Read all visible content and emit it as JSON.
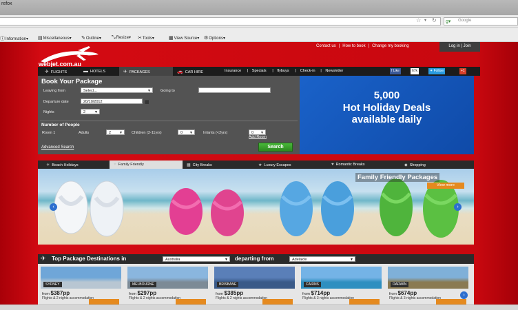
{
  "browser": {
    "title": "refox",
    "search_placeholder": "Google",
    "toolbar": [
      {
        "icon": "info-icon",
        "glyph": "ⓘ",
        "label": "Information"
      },
      {
        "icon": "folder-icon",
        "glyph": "▤",
        "label": "Miscellaneous"
      },
      {
        "icon": "outline-icon",
        "glyph": "✎",
        "label": "Outline"
      },
      {
        "icon": "resize-icon",
        "glyph": "⤡",
        "label": "Resize"
      },
      {
        "icon": "tools-icon",
        "glyph": "✂",
        "label": "Tools"
      },
      {
        "icon": "view-source-icon",
        "glyph": "▦",
        "label": "View Source"
      },
      {
        "icon": "options-icon",
        "glyph": "⚙",
        "label": "Options"
      }
    ]
  },
  "site": {
    "logo_text": "webjet.com.au",
    "top_links": [
      "Contact us",
      "|",
      "How to book",
      "|",
      "Change my booking"
    ],
    "login": "Log in | Join"
  },
  "nav": {
    "tabs": [
      {
        "label": "FLIGHTS",
        "icon": "plane-icon"
      },
      {
        "label": "HOTELS",
        "icon": "bed-icon"
      },
      {
        "label": "PACKAGES",
        "icon": "package-icon"
      },
      {
        "label": "CAR HIRE",
        "icon": "car-icon"
      }
    ],
    "links": [
      "Insurance",
      "|",
      "Specials",
      "|",
      "flybuys",
      "|",
      "Check-in",
      "|",
      "Newsletter"
    ],
    "like_label": "Like",
    "like_count": "67k",
    "follow_label": "Follow",
    "gplus_label": "+1"
  },
  "booking": {
    "title": "Book Your Package",
    "leaving_from_label": "Leaving from",
    "leaving_from_value": "Select...",
    "going_to_label": "Going to",
    "going_to_value": "",
    "departure_label": "Departure date",
    "departure_value": "20/10/2012",
    "nights_label": "Nights",
    "nights_value": "2",
    "people_title": "Number of People",
    "room_label": "Room 1",
    "adults_label": "Adults",
    "adults_value": "2",
    "children_label": "Children (2-11yrs)",
    "children_value": "0",
    "infants_label": "Infants (<2yrs)",
    "infants_value": "0",
    "add_room": "Add Room",
    "advanced_search": "Advanced Search",
    "search_button": "Search"
  },
  "promo": {
    "line1": "5,000",
    "line2": "Hot Holiday Deals",
    "line3": "available daily"
  },
  "categories": [
    {
      "label": "Beach Holidays",
      "icon": "beach-icon",
      "glyph": "☀"
    },
    {
      "label": "Family Friendly",
      "icon": "family-icon",
      "glyph": "♥"
    },
    {
      "label": "City Breaks",
      "icon": "city-icon",
      "glyph": "▦"
    },
    {
      "label": "Luxury Escapes",
      "icon": "star-icon",
      "glyph": "★"
    },
    {
      "label": "Romantic Breaks",
      "icon": "heart-icon",
      "glyph": "♥"
    },
    {
      "label": "Shopping",
      "icon": "bag-icon",
      "glyph": "◆"
    }
  ],
  "banner": {
    "title": "Family Friendly Packages",
    "view_more": "View more"
  },
  "destinations": {
    "title": "Top Package Destinations in",
    "country": "Australia",
    "departing_label": "departing from",
    "departing_value": "Adelaide",
    "cards": [
      {
        "name": "SYDNEY",
        "price_prefix": "from",
        "price": "$387pp",
        "note": "Flights & 2 nights accommodation"
      },
      {
        "name": "MELBOURNE",
        "price_prefix": "from",
        "price": "$297pp",
        "note": "Flights & 2 nights accommodation"
      },
      {
        "name": "BRISBANE",
        "price_prefix": "from",
        "price": "$385pp",
        "note": "Flights & 2 nights accommodation"
      },
      {
        "name": "CAIRNS",
        "price_prefix": "from",
        "price": "$714pp",
        "note": "Flights & 3 nights accommodation"
      },
      {
        "name": "DARWIN",
        "price_prefix": "from",
        "price": "$674pp",
        "note": "Flights & 3 nights accommodation"
      }
    ]
  },
  "colors": {
    "brand_red": "#c2080e",
    "promo_blue": "#1a62c9",
    "search_green": "#2c8a1f",
    "accent_orange": "#e58a1f"
  }
}
